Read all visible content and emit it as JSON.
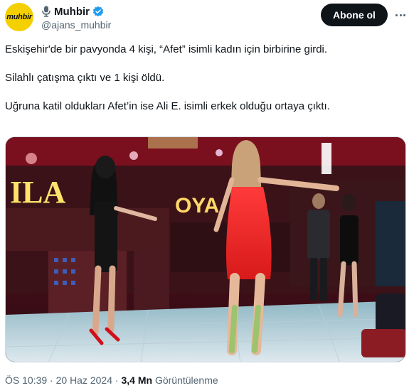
{
  "author": {
    "avatar_text": "muhbir",
    "display_name": "Muhbir",
    "handle": "@ajans_muhbir",
    "verified": true,
    "badge_icon": "verified-badge-icon",
    "prefix_icon": "microphone-icon",
    "verified_color": "#1d9bf0"
  },
  "actions": {
    "follow_label": "Abone ol",
    "more_icon": "more-options-icon"
  },
  "tweet": {
    "paragraphs": [
      "Eskişehir'de bir pavyonda 4 kişi, “Afet” isimli kadın için birbirine girdi.",
      "Silahlı çatışma çıktı ve 1 kişi öldü.",
      "Uğruna katil oldukları Afet’in ise Ali E. isimli erkek olduğu ortaya çıktı."
    ],
    "media_sign_left": "ILA",
    "media_sign_right": "OYA"
  },
  "meta": {
    "time": "ÖS 10:39",
    "date": "20 Haz 2024",
    "views_count": "3,4 Mn",
    "views_label": "Görüntülenme",
    "separator": "·"
  }
}
